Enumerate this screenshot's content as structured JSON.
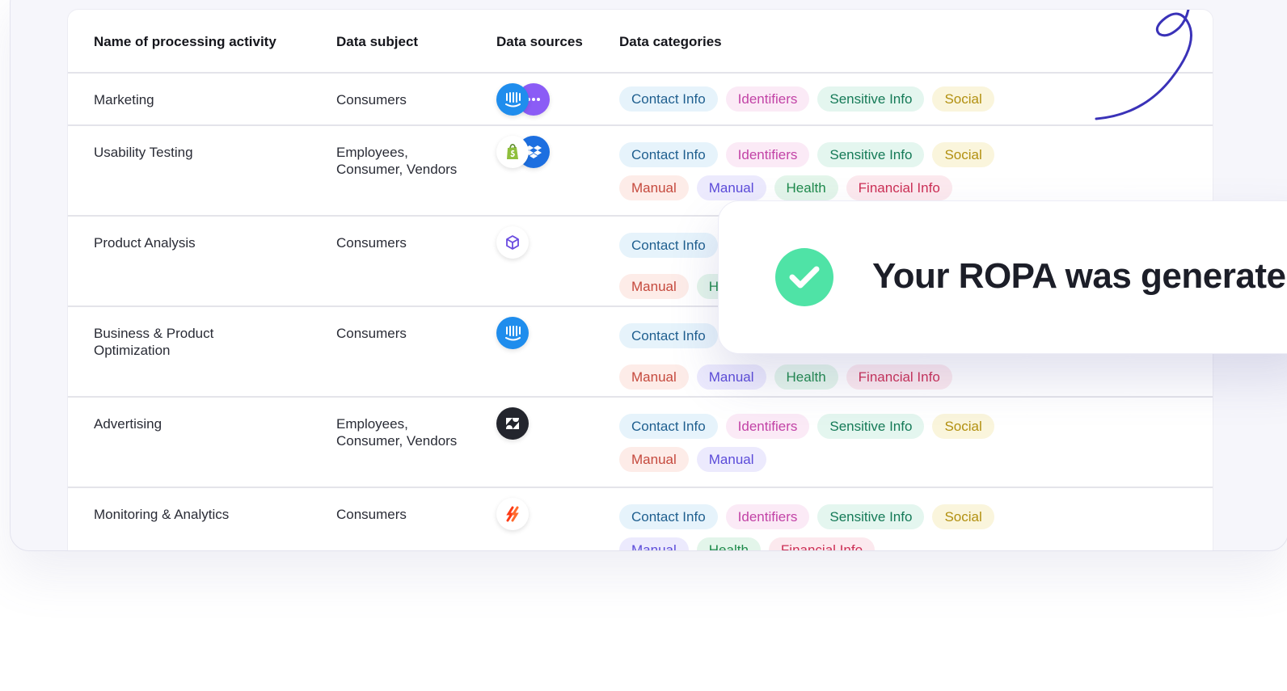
{
  "table": {
    "headers": {
      "name": "Name of processing activity",
      "subject": "Data subject",
      "sources": "Data sources",
      "categories": "Data categories"
    },
    "rows": [
      {
        "name": "Marketing",
        "subject_line1": "Consumers",
        "subject_line2": "",
        "sources": [
          "intercom-icon",
          "chat-icon"
        ],
        "categories_row1": [
          "Contact Info",
          "Identifiers",
          "Sensitive Info",
          "Social"
        ],
        "categories_row2": []
      },
      {
        "name": "Usability Testing",
        "subject_line1": "Employees,",
        "subject_line2": "Consumer, Vendors",
        "sources": [
          "shopify-icon",
          "dropbox-icon"
        ],
        "categories_row1": [
          "Contact Info",
          "Identifiers",
          "Sensitive Info",
          "Social"
        ],
        "categories_row2": [
          "Manual",
          "Manual",
          "Health",
          "Financial Info"
        ]
      },
      {
        "name": "Product Analysis",
        "subject_line1": "Consumers",
        "subject_line2": "",
        "sources": [
          "cube-icon"
        ],
        "categories_row1": [
          "Contact Info"
        ],
        "categories_row2": [
          "Manual",
          "H"
        ]
      },
      {
        "name_line1": "Business & Product",
        "name_line2": "Optimization",
        "subject_line1": "Consumers",
        "subject_line2": "",
        "sources": [
          "intercom-icon"
        ],
        "categories_row1": [
          "Contact Info"
        ],
        "categories_row2": [
          "Manual",
          "Manual",
          "Health",
          "Financial Info"
        ]
      },
      {
        "name": "Advertising",
        "subject_line1": "Employees,",
        "subject_line2": "Consumer, Vendors",
        "sources": [
          "zendesk-icon"
        ],
        "categories_row1": [
          "Contact Info",
          "Identifiers",
          "Sensitive Info",
          "Social"
        ],
        "categories_row2": [
          "Manual",
          "Manual"
        ]
      },
      {
        "name": "Monitoring & Analytics",
        "subject_line1": "Consumers",
        "subject_line2": "",
        "sources": [
          "hotjar-icon"
        ],
        "categories_row1": [
          "Contact Info",
          "Identifiers",
          "Sensitive Info",
          "Social"
        ],
        "categories_row2": [
          "Manual",
          "Health",
          "Financial Info"
        ]
      }
    ]
  },
  "toast": {
    "message": "Your ROPA was generated",
    "icon": "checkmark-icon",
    "accent": "#4fe3a6"
  },
  "colors": {
    "swirl": "#3a32b8"
  }
}
